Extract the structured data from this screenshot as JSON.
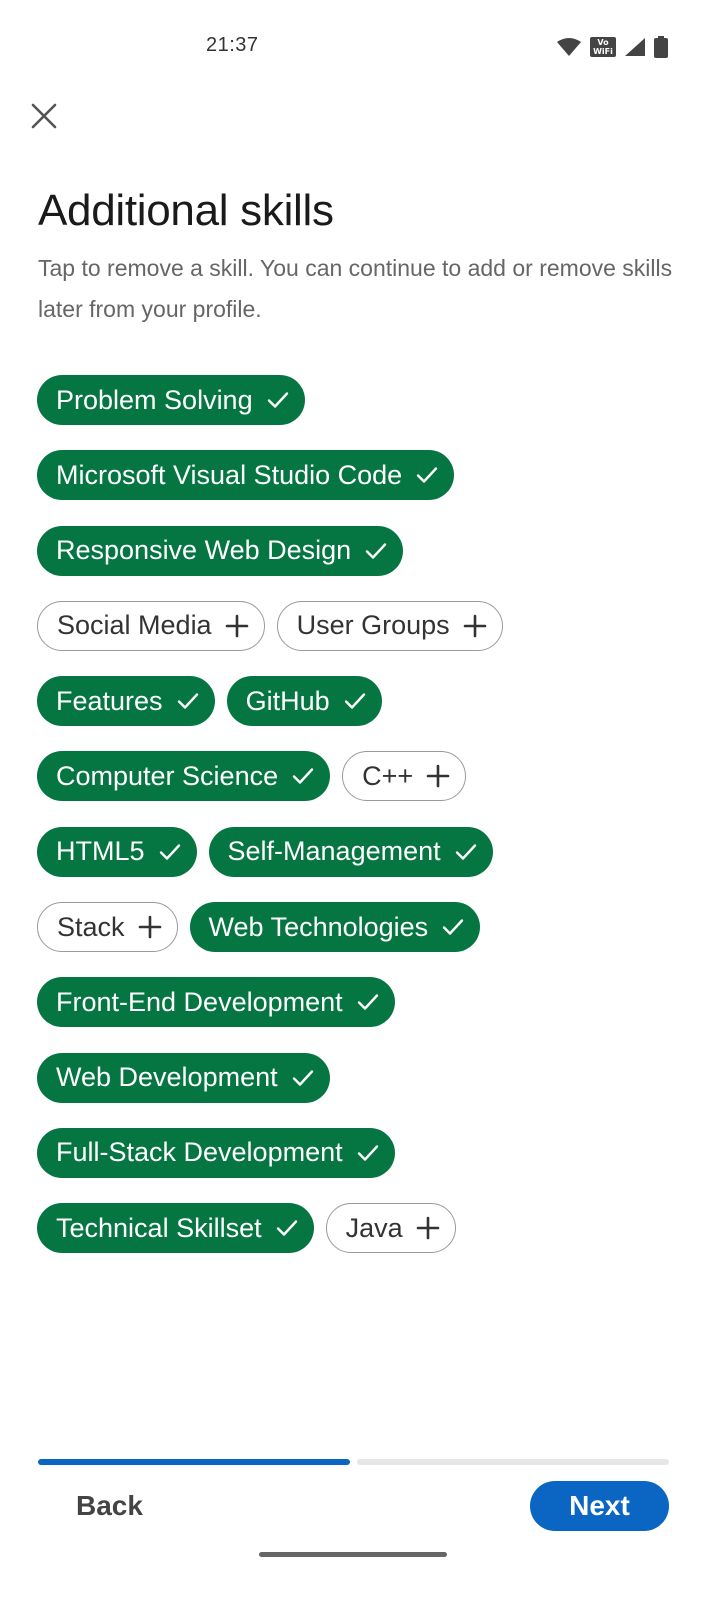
{
  "status_bar": {
    "time": "21:37",
    "icons": [
      "wifi-icon",
      "vowifi-icon",
      "cellular-signal-icon",
      "battery-icon"
    ],
    "vowifi_line1": "Vo",
    "vowifi_line2": "WiFi"
  },
  "header": {
    "close_icon": "close-icon",
    "title": "Additional skills",
    "subtitle": "Tap to remove a skill. You can continue to add or remove skills later from your profile."
  },
  "skills": [
    {
      "label": "Problem Solving",
      "selected": true
    },
    {
      "label": "Microsoft Visual Studio Code",
      "selected": true
    },
    {
      "label": "Responsive Web Design",
      "selected": true
    },
    {
      "label": "Social Media",
      "selected": false
    },
    {
      "label": "User Groups",
      "selected": false
    },
    {
      "label": "Features",
      "selected": true
    },
    {
      "label": "GitHub",
      "selected": true
    },
    {
      "label": "Computer Science",
      "selected": true
    },
    {
      "label": "C++",
      "selected": false
    },
    {
      "label": "HTML5",
      "selected": true
    },
    {
      "label": "Self-Management",
      "selected": true
    },
    {
      "label": "Stack",
      "selected": false
    },
    {
      "label": "Web Technologies",
      "selected": true
    },
    {
      "label": "Front-End Development",
      "selected": true
    },
    {
      "label": "Web Development",
      "selected": true
    },
    {
      "label": "Full-Stack Development",
      "selected": true
    },
    {
      "label": "Technical Skillset",
      "selected": true
    },
    {
      "label": "Java",
      "selected": false
    }
  ],
  "progress": {
    "current_step": 1,
    "total_steps": 2
  },
  "footer": {
    "back_label": "Back",
    "next_label": "Next"
  },
  "colors": {
    "selected_chip": "#057642",
    "primary_blue": "#0a66c2",
    "unselected_border": "#9a9a9a"
  }
}
